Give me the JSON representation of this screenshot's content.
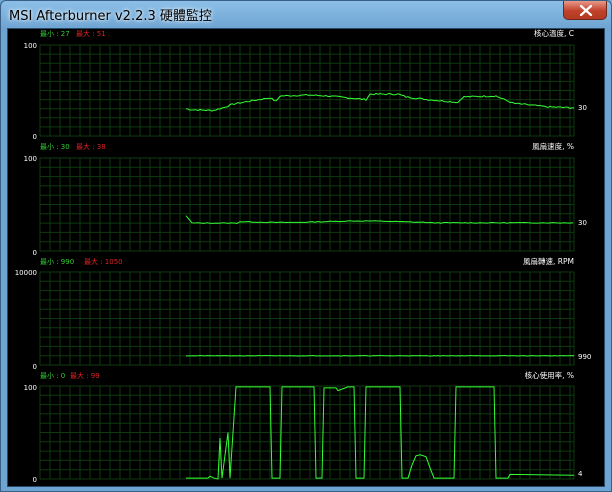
{
  "window": {
    "title": "MSI Afterburner v2.2.3 硬體監控"
  },
  "colors": {
    "grid": "#0f3a0f",
    "plot_bg": "#000000",
    "line": "#33ff33",
    "min_label": "#33cc33",
    "max_label": "#dd2222",
    "text": "#ffffff"
  },
  "graphs": [
    {
      "id": "core-temp",
      "title": "核心溫度, C",
      "min_label": "最小 : 27",
      "max_label": "最大 : 51",
      "y_max": "100",
      "y_min": "0",
      "current": "30"
    },
    {
      "id": "fan-speed",
      "title": "風扇速度, %",
      "min_label": "最小 : 30",
      "max_label": "最大 : 38",
      "y_max": "100",
      "y_min": "0",
      "current": "30"
    },
    {
      "id": "fan-rpm",
      "title": "風扇轉速, RPM",
      "min_label": "最小 : 990",
      "max_label": "最大 : 1050",
      "y_max": "10000",
      "y_min": "0",
      "current": "990"
    },
    {
      "id": "core-usage",
      "title": "核心使用率, %",
      "min_label": "最小 : 0",
      "max_label": "最大 : 99",
      "y_max": "100",
      "y_min": "0",
      "current": "4"
    }
  ]
}
